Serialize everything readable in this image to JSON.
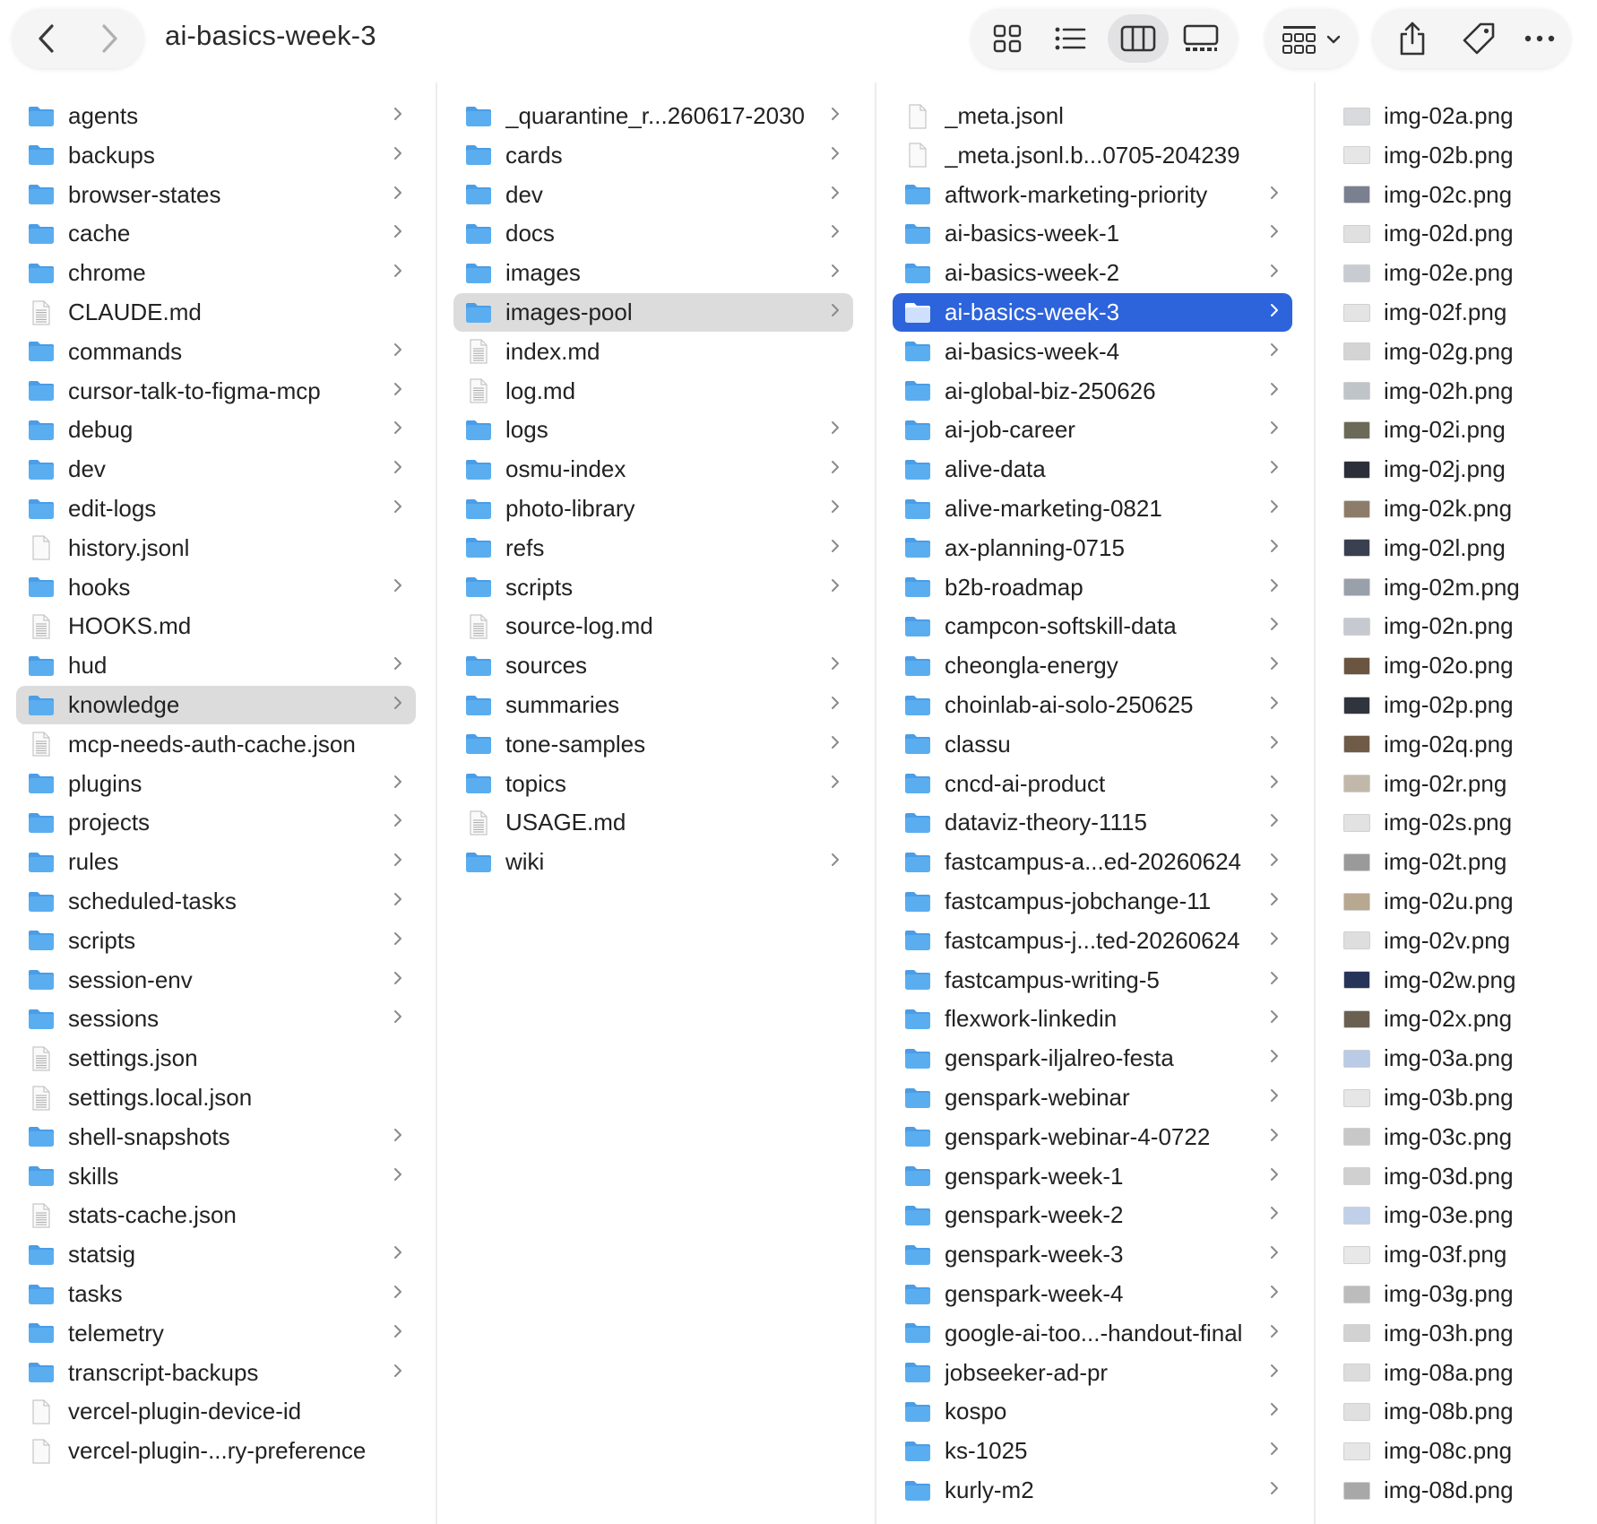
{
  "window": {
    "title": "ai-basics-week-3"
  },
  "toolbar": {
    "back": "chevron-left-icon",
    "forward": "chevron-right-icon",
    "views": [
      "icon-view-icon",
      "list-view-icon",
      "column-view-icon",
      "gallery-view-icon"
    ],
    "active_view": "column-view-icon",
    "group": "group-by-icon",
    "actions": [
      "share-icon",
      "tag-icon",
      "more-icon"
    ]
  },
  "colors": {
    "folder": "#5aaef0",
    "folder_tab": "#4a9de6",
    "selection_blue": "#2d63db",
    "selection_gray": "#dcdcdc"
  },
  "columns": [
    {
      "items": [
        {
          "name": "agents",
          "type": "folder"
        },
        {
          "name": "backups",
          "type": "folder"
        },
        {
          "name": "browser-states",
          "type": "folder"
        },
        {
          "name": "cache",
          "type": "folder"
        },
        {
          "name": "chrome",
          "type": "folder"
        },
        {
          "name": "CLAUDE.md",
          "type": "doc"
        },
        {
          "name": "commands",
          "type": "folder"
        },
        {
          "name": "cursor-talk-to-figma-mcp",
          "type": "folder"
        },
        {
          "name": "debug",
          "type": "folder"
        },
        {
          "name": "dev",
          "type": "folder"
        },
        {
          "name": "edit-logs",
          "type": "folder"
        },
        {
          "name": "history.jsonl",
          "type": "file"
        },
        {
          "name": "hooks",
          "type": "folder"
        },
        {
          "name": "HOOKS.md",
          "type": "doc"
        },
        {
          "name": "hud",
          "type": "folder"
        },
        {
          "name": "knowledge",
          "type": "folder",
          "selected": "gray"
        },
        {
          "name": "mcp-needs-auth-cache.json",
          "type": "doc"
        },
        {
          "name": "plugins",
          "type": "folder"
        },
        {
          "name": "projects",
          "type": "folder"
        },
        {
          "name": "rules",
          "type": "folder"
        },
        {
          "name": "scheduled-tasks",
          "type": "folder"
        },
        {
          "name": "scripts",
          "type": "folder"
        },
        {
          "name": "session-env",
          "type": "folder"
        },
        {
          "name": "sessions",
          "type": "folder"
        },
        {
          "name": "settings.json",
          "type": "doc"
        },
        {
          "name": "settings.local.json",
          "type": "doc"
        },
        {
          "name": "shell-snapshots",
          "type": "folder"
        },
        {
          "name": "skills",
          "type": "folder"
        },
        {
          "name": "stats-cache.json",
          "type": "doc"
        },
        {
          "name": "statsig",
          "type": "folder"
        },
        {
          "name": "tasks",
          "type": "folder"
        },
        {
          "name": "telemetry",
          "type": "folder"
        },
        {
          "name": "transcript-backups",
          "type": "folder"
        },
        {
          "name": "vercel-plugin-device-id",
          "type": "file"
        },
        {
          "name": "vercel-plugin-...ry-preference",
          "type": "file"
        }
      ]
    },
    {
      "items": [
        {
          "name": "_quarantine_r...260617-2030",
          "type": "folder"
        },
        {
          "name": "cards",
          "type": "folder"
        },
        {
          "name": "dev",
          "type": "folder"
        },
        {
          "name": "docs",
          "type": "folder"
        },
        {
          "name": "images",
          "type": "folder"
        },
        {
          "name": "images-pool",
          "type": "folder",
          "selected": "gray"
        },
        {
          "name": "index.md",
          "type": "doc"
        },
        {
          "name": "log.md",
          "type": "doc"
        },
        {
          "name": "logs",
          "type": "folder"
        },
        {
          "name": "osmu-index",
          "type": "folder"
        },
        {
          "name": "photo-library",
          "type": "folder"
        },
        {
          "name": "refs",
          "type": "folder"
        },
        {
          "name": "scripts",
          "type": "folder"
        },
        {
          "name": "source-log.md",
          "type": "doc"
        },
        {
          "name": "sources",
          "type": "folder"
        },
        {
          "name": "summaries",
          "type": "folder"
        },
        {
          "name": "tone-samples",
          "type": "folder"
        },
        {
          "name": "topics",
          "type": "folder"
        },
        {
          "name": "USAGE.md",
          "type": "doc"
        },
        {
          "name": "wiki",
          "type": "folder"
        }
      ]
    },
    {
      "items": [
        {
          "name": "_meta.jsonl",
          "type": "file"
        },
        {
          "name": "_meta.jsonl.b...0705-204239",
          "type": "file"
        },
        {
          "name": "aftwork-marketing-priority",
          "type": "folder"
        },
        {
          "name": "ai-basics-week-1",
          "type": "folder"
        },
        {
          "name": "ai-basics-week-2",
          "type": "folder"
        },
        {
          "name": "ai-basics-week-3",
          "type": "folder",
          "selected": "blue"
        },
        {
          "name": "ai-basics-week-4",
          "type": "folder"
        },
        {
          "name": "ai-global-biz-250626",
          "type": "folder"
        },
        {
          "name": "ai-job-career",
          "type": "folder"
        },
        {
          "name": "alive-data",
          "type": "folder"
        },
        {
          "name": "alive-marketing-0821",
          "type": "folder"
        },
        {
          "name": "ax-planning-0715",
          "type": "folder"
        },
        {
          "name": "b2b-roadmap",
          "type": "folder"
        },
        {
          "name": "campcon-softskill-data",
          "type": "folder"
        },
        {
          "name": "cheongla-energy",
          "type": "folder"
        },
        {
          "name": "choinlab-ai-solo-250625",
          "type": "folder"
        },
        {
          "name": "classu",
          "type": "folder"
        },
        {
          "name": "cncd-ai-product",
          "type": "folder"
        },
        {
          "name": "dataviz-theory-1115",
          "type": "folder"
        },
        {
          "name": "fastcampus-a...ed-20260624",
          "type": "folder"
        },
        {
          "name": "fastcampus-jobchange-11",
          "type": "folder"
        },
        {
          "name": "fastcampus-j...ted-20260624",
          "type": "folder"
        },
        {
          "name": "fastcampus-writing-5",
          "type": "folder"
        },
        {
          "name": "flexwork-linkedin",
          "type": "folder"
        },
        {
          "name": "genspark-iljalreo-festa",
          "type": "folder"
        },
        {
          "name": "genspark-webinar",
          "type": "folder"
        },
        {
          "name": "genspark-webinar-4-0722",
          "type": "folder"
        },
        {
          "name": "genspark-week-1",
          "type": "folder"
        },
        {
          "name": "genspark-week-2",
          "type": "folder"
        },
        {
          "name": "genspark-week-3",
          "type": "folder"
        },
        {
          "name": "genspark-week-4",
          "type": "folder"
        },
        {
          "name": "google-ai-too...-handout-final",
          "type": "folder"
        },
        {
          "name": "jobseeker-ad-pr",
          "type": "folder"
        },
        {
          "name": "kospo",
          "type": "folder"
        },
        {
          "name": "ks-1025",
          "type": "folder"
        },
        {
          "name": "kurly-m2",
          "type": "folder"
        }
      ]
    },
    {
      "items": [
        {
          "name": "img-02a.png",
          "type": "image",
          "thumb": "#d8dadd"
        },
        {
          "name": "img-02b.png",
          "type": "image",
          "thumb": "#e6e6e6"
        },
        {
          "name": "img-02c.png",
          "type": "image",
          "thumb": "#7a8090"
        },
        {
          "name": "img-02d.png",
          "type": "image",
          "thumb": "#e0e0e0"
        },
        {
          "name": "img-02e.png",
          "type": "image",
          "thumb": "#c8ccd2"
        },
        {
          "name": "img-02f.png",
          "type": "image",
          "thumb": "#e4e4e4"
        },
        {
          "name": "img-02g.png",
          "type": "image",
          "thumb": "#d4d4d4"
        },
        {
          "name": "img-02h.png",
          "type": "image",
          "thumb": "#bfc4c9"
        },
        {
          "name": "img-02i.png",
          "type": "image",
          "thumb": "#6b6a58"
        },
        {
          "name": "img-02j.png",
          "type": "image",
          "thumb": "#2b2f3a"
        },
        {
          "name": "img-02k.png",
          "type": "image",
          "thumb": "#8e7c6a"
        },
        {
          "name": "img-02l.png",
          "type": "image",
          "thumb": "#3b4050"
        },
        {
          "name": "img-02m.png",
          "type": "image",
          "thumb": "#9aa0aa"
        },
        {
          "name": "img-02n.png",
          "type": "image",
          "thumb": "#c6cad0"
        },
        {
          "name": "img-02o.png",
          "type": "image",
          "thumb": "#6a5540"
        },
        {
          "name": "img-02p.png",
          "type": "image",
          "thumb": "#30343c"
        },
        {
          "name": "img-02q.png",
          "type": "image",
          "thumb": "#705a48"
        },
        {
          "name": "img-02r.png",
          "type": "image",
          "thumb": "#c2b8aa"
        },
        {
          "name": "img-02s.png",
          "type": "image",
          "thumb": "#e2e2e2"
        },
        {
          "name": "img-02t.png",
          "type": "image",
          "thumb": "#9a9a9a"
        },
        {
          "name": "img-02u.png",
          "type": "image",
          "thumb": "#b8a890"
        },
        {
          "name": "img-02v.png",
          "type": "image",
          "thumb": "#dedede"
        },
        {
          "name": "img-02w.png",
          "type": "image",
          "thumb": "#27345a"
        },
        {
          "name": "img-02x.png",
          "type": "image",
          "thumb": "#6a6052"
        },
        {
          "name": "img-03a.png",
          "type": "image",
          "thumb": "#b9cbe6"
        },
        {
          "name": "img-03b.png",
          "type": "image",
          "thumb": "#e6e6e6"
        },
        {
          "name": "img-03c.png",
          "type": "image",
          "thumb": "#c8c8c8"
        },
        {
          "name": "img-03d.png",
          "type": "image",
          "thumb": "#d0d0d0"
        },
        {
          "name": "img-03e.png",
          "type": "image",
          "thumb": "#c0d0ea"
        },
        {
          "name": "img-03f.png",
          "type": "image",
          "thumb": "#e8e8e8"
        },
        {
          "name": "img-03g.png",
          "type": "image",
          "thumb": "#bcbcbc"
        },
        {
          "name": "img-03h.png",
          "type": "image",
          "thumb": "#d2d2d2"
        },
        {
          "name": "img-08a.png",
          "type": "image",
          "thumb": "#dcdcdc"
        },
        {
          "name": "img-08b.png",
          "type": "image",
          "thumb": "#e0e0e0"
        },
        {
          "name": "img-08c.png",
          "type": "image",
          "thumb": "#e6e6e6"
        },
        {
          "name": "img-08d.png",
          "type": "image",
          "thumb": "#a8a8a8"
        }
      ]
    }
  ]
}
